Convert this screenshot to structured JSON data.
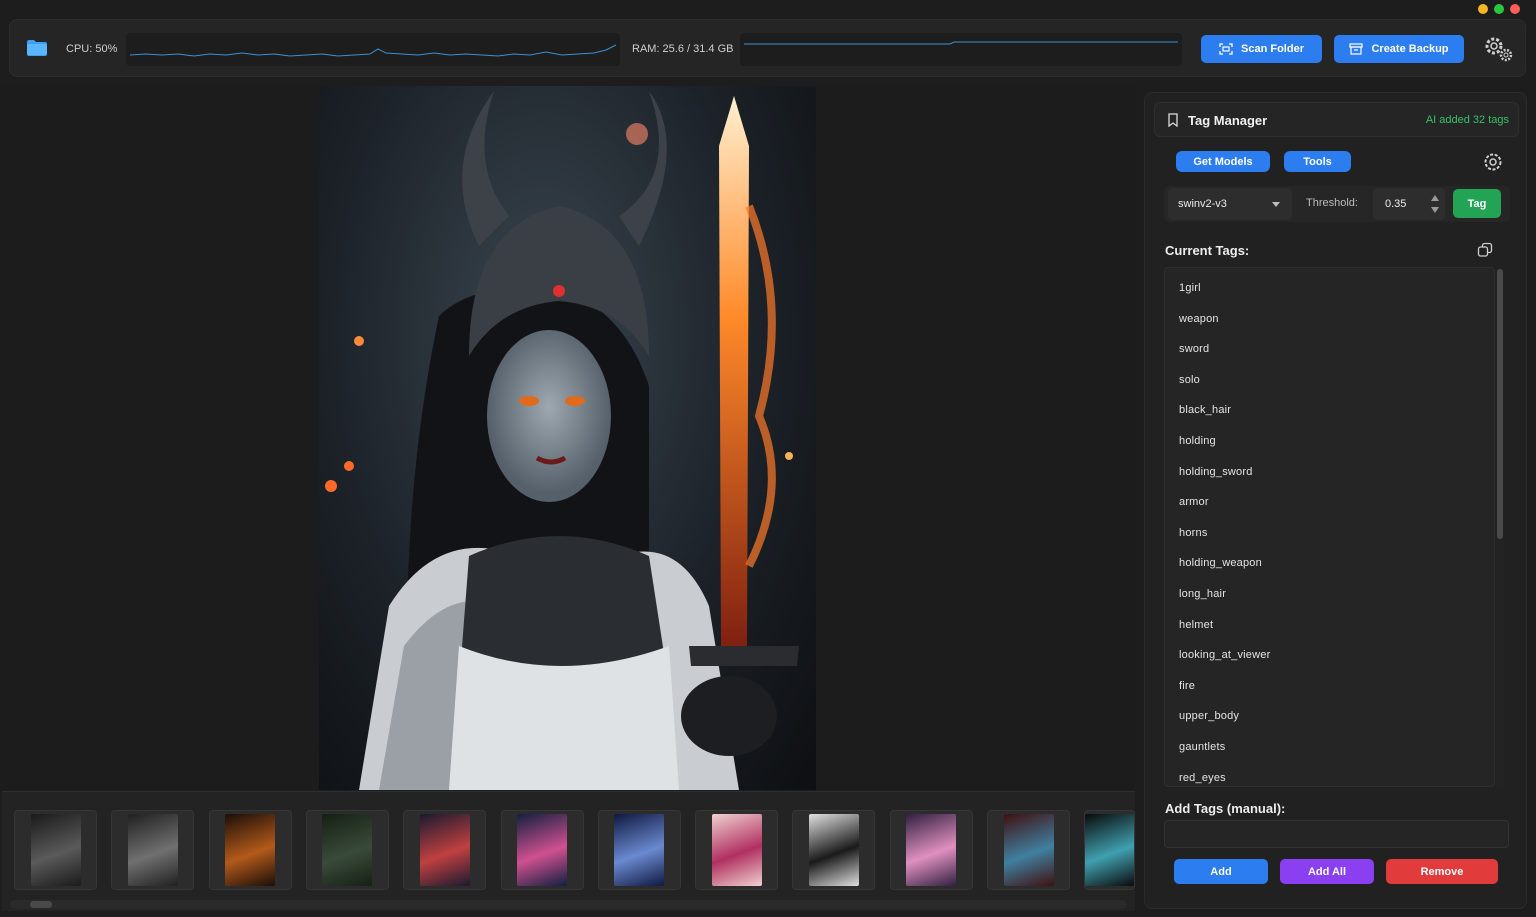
{
  "window": {
    "traffic_lights": [
      "#f5b526",
      "#27c840",
      "#ff5f57"
    ]
  },
  "topbar": {
    "folder_icon": "folder-icon",
    "cpu_label": "CPU: 50%",
    "ram_label": "RAM: 25.6 / 31.4 GB",
    "scan_folder_label": "Scan Folder",
    "create_backup_label": "Create Backup",
    "settings_icon": "gear-icon",
    "accent": "#2b7df0"
  },
  "viewer": {
    "image_description_icon": "main-image"
  },
  "filmstrip": {
    "thumbnails": [
      {
        "colors": [
          "#1a1a1a",
          "#5a5a5a"
        ]
      },
      {
        "colors": [
          "#202020",
          "#707070"
        ]
      },
      {
        "colors": [
          "#1a0e08",
          "#b35a1a"
        ]
      },
      {
        "colors": [
          "#142014",
          "#3a4a3a"
        ]
      },
      {
        "colors": [
          "#1a1a30",
          "#c04040"
        ]
      },
      {
        "colors": [
          "#102040",
          "#d05090"
        ]
      },
      {
        "colors": [
          "#101840",
          "#6a8ad0"
        ]
      },
      {
        "colors": [
          "#f0d0d0",
          "#b03060"
        ]
      },
      {
        "colors": [
          "#e0e0e0",
          "#1a1a1a"
        ]
      },
      {
        "colors": [
          "#302040",
          "#e090c0"
        ]
      },
      {
        "colors": [
          "#401010",
          "#4080a0"
        ]
      },
      {
        "colors": [
          "#0a0a0a",
          "#40a0b0"
        ]
      }
    ]
  },
  "panel": {
    "title": "Tag Manager",
    "status": "AI added 32 tags",
    "status_color": "#35c16b",
    "get_models_label": "Get Models",
    "tools_label": "Tools",
    "model": "swinv2-v3",
    "threshold_label": "Threshold:",
    "threshold_value": "0.35",
    "tag_button_label": "Tag",
    "current_tags_label": "Current Tags:",
    "tags": [
      "1girl",
      "weapon",
      "sword",
      "solo",
      "black_hair",
      "holding",
      "holding_sword",
      "armor",
      "horns",
      "holding_weapon",
      "long_hair",
      "helmet",
      "looking_at_viewer",
      "fire",
      "upper_body",
      "gauntlets",
      "red_eyes"
    ],
    "add_tags_label": "Add Tags (manual):",
    "manual_placeholder": "",
    "add_label": "Add",
    "add_all_label": "Add All",
    "remove_label": "Remove",
    "add_color": "#2b7df0",
    "add_all_color": "#8a3ff0",
    "remove_color": "#e23b3b"
  }
}
